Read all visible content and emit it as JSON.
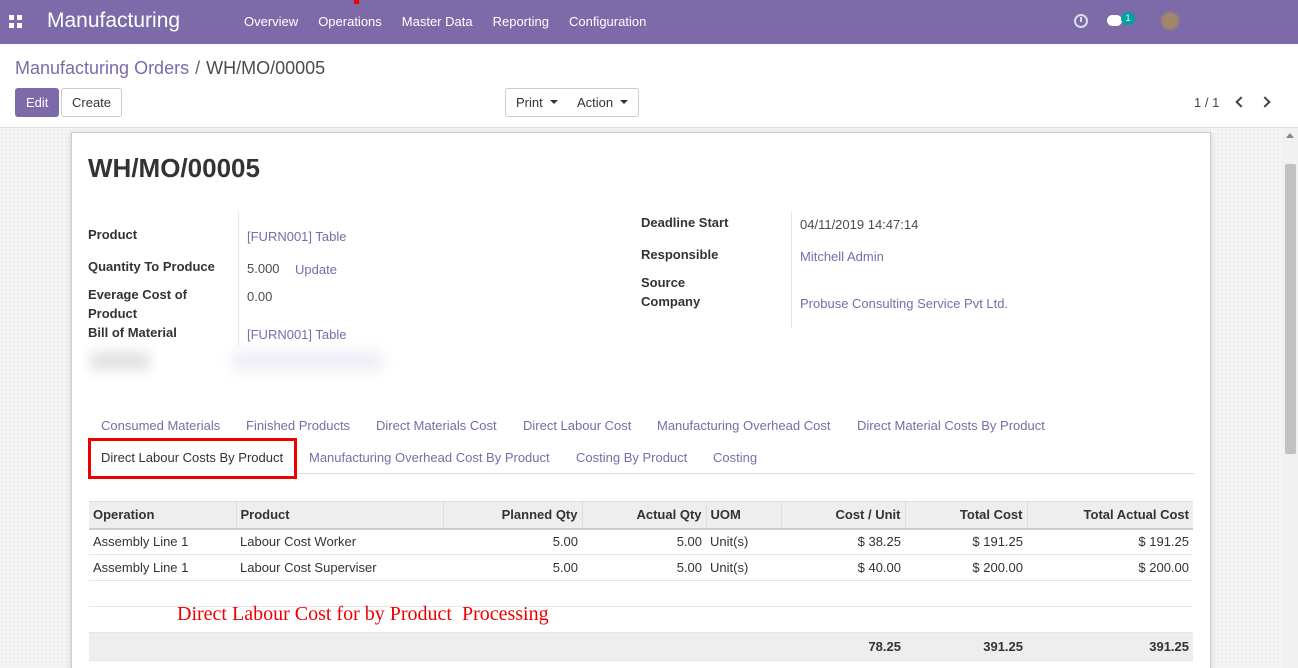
{
  "navbar": {
    "brand": "Manufacturing",
    "menu": [
      "Overview",
      "Operations",
      "Master Data",
      "Reporting",
      "Configuration"
    ],
    "chat_count": "1",
    "icons": [
      "apps-icon",
      "clock-icon",
      "chat-icon"
    ],
    "accent_color": "#7c6ba8"
  },
  "breadcrumb": {
    "parent": "Manufacturing Orders",
    "separator": "/",
    "current": "WH/MO/00005"
  },
  "buttons": {
    "edit": "Edit",
    "create": "Create",
    "print": "Print",
    "action": "Action"
  },
  "pager": {
    "value": "1 / 1"
  },
  "record": {
    "title": "WH/MO/00005",
    "left_fields": {
      "product": {
        "label": "Product",
        "value": "[FURN001] Table"
      },
      "quantity": {
        "label": "Quantity To Produce",
        "value": "5.000",
        "action": "Update"
      },
      "avg_cost": {
        "label": "Everage Cost of Product",
        "value": "0.00"
      },
      "bom": {
        "label": "Bill of Material",
        "value": "[FURN001] Table"
      }
    },
    "right_fields": {
      "deadline": {
        "label": "Deadline Start",
        "value": "04/11/2019 14:47:14"
      },
      "responsible": {
        "label": "Responsible",
        "value": "Mitchell Admin"
      },
      "source": {
        "label": "Source",
        "value": ""
      },
      "company": {
        "label": "Company",
        "value": "Probuse Consulting Service Pvt Ltd."
      }
    }
  },
  "tabs": {
    "row1": [
      "Consumed Materials",
      "Finished Products",
      "Direct Materials Cost",
      "Direct Labour Cost",
      "Manufacturing Overhead Cost",
      "Direct Material Costs By Product"
    ],
    "row2": [
      "Direct Labour Costs By Product",
      "Manufacturing Overhead Cost By Product",
      "Costing By Product",
      "Costing"
    ],
    "active": "Direct Labour Costs By Product"
  },
  "table": {
    "columns": [
      "Operation",
      "Product",
      "Planned Qty",
      "Actual Qty",
      "UOM",
      "Cost / Unit",
      "Total Cost",
      "Total Actual Cost"
    ],
    "rows": [
      [
        "Assembly Line 1",
        "Labour Cost Worker",
        "5.00",
        "5.00",
        "Unit(s)",
        "$ 38.25",
        "$ 191.25",
        "$ 191.25"
      ],
      [
        "Assembly Line 1",
        "Labour Cost Superviser",
        "5.00",
        "5.00",
        "Unit(s)",
        "$ 40.00",
        "$ 200.00",
        "$ 200.00"
      ]
    ],
    "totals": {
      "cost_unit": "78.25",
      "total_cost": "391.25",
      "total_actual": "391.25"
    }
  },
  "annotation": "Direct Labour Cost for by Product  Processing"
}
